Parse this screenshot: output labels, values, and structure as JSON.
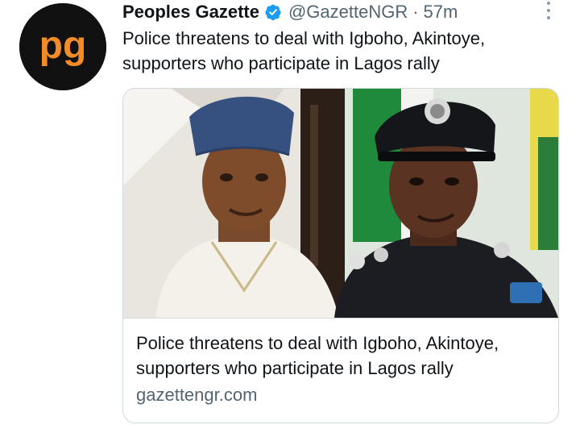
{
  "tweet": {
    "author_name": "Peoples Gazette",
    "handle": "@GazetteNGR",
    "separator": "·",
    "time": "57m",
    "text": "Police threatens to deal with Igboho, Akintoye, supporters who participate in Lagos rally",
    "avatar_letters": "pg",
    "colors": {
      "brand_orange": "#f28c28",
      "avatar_bg": "#111111",
      "verified_blue": "#1d9bf0"
    }
  },
  "card": {
    "title": "Police threatens to deal with Igboho, Akintoye, supporters who participate in Lagos rally",
    "domain": "gazettengr.com"
  }
}
